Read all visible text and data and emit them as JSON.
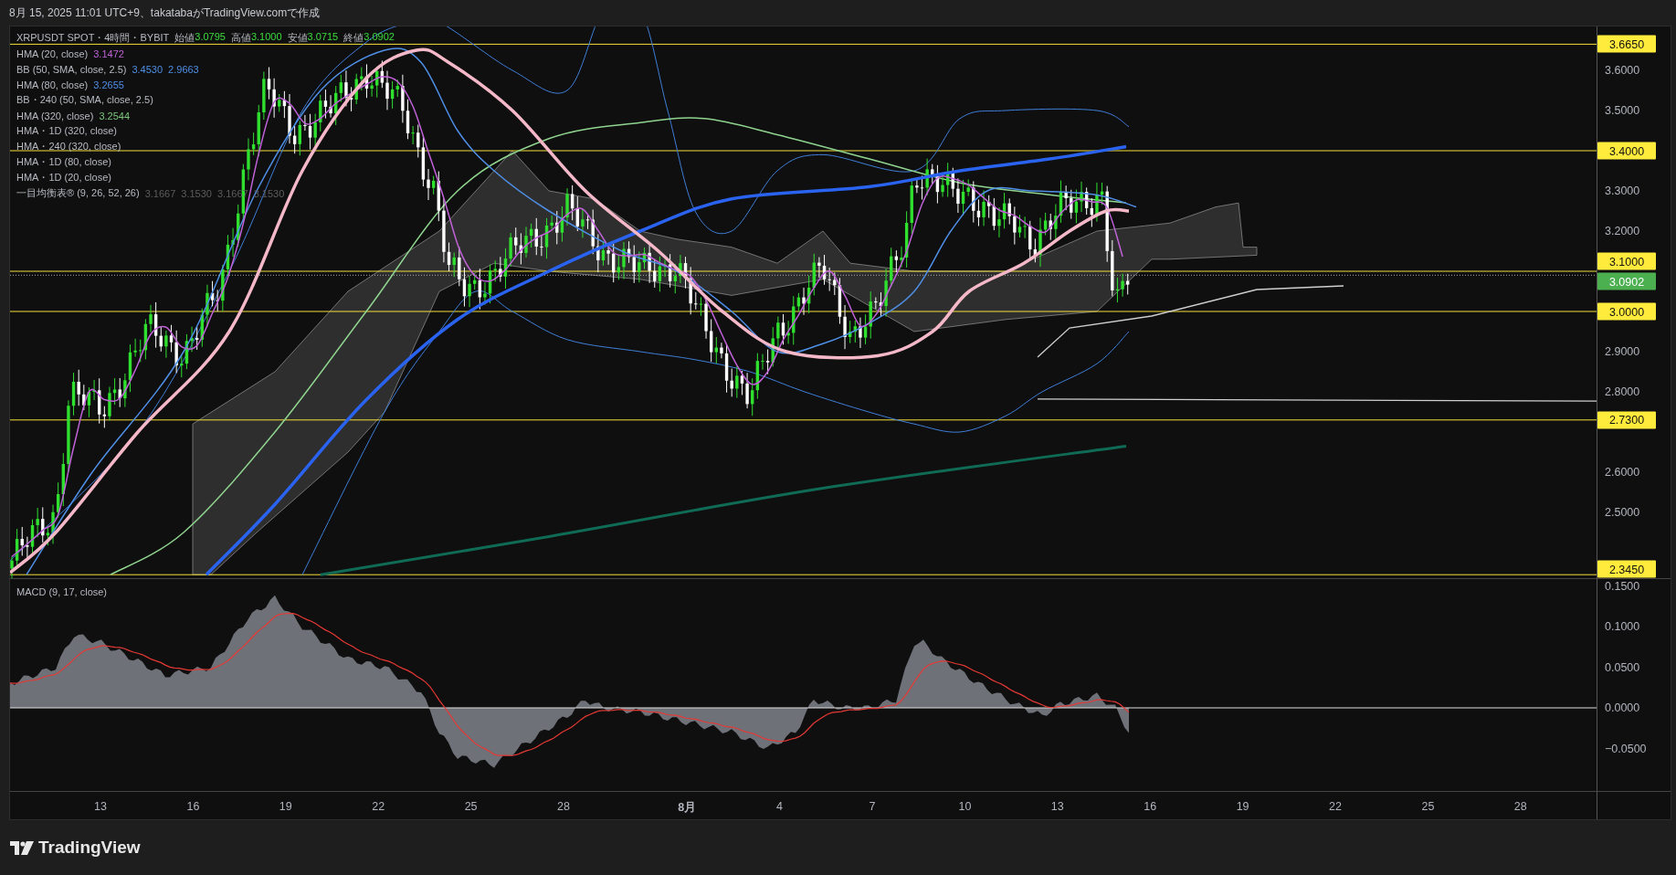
{
  "header": {
    "caption": "8月 15, 2025 11:01 UTC+9、takatabaがTradingView.comで作成"
  },
  "legend": {
    "symbol": "XRPUSDT SPOT・4時間・BYBIT",
    "ohlc": [
      {
        "label": "始値",
        "value": "3.0795"
      },
      {
        "label": "高値",
        "value": "3.1000"
      },
      {
        "label": "安値",
        "value": "3.0715"
      },
      {
        "label": "終値",
        "value": "3.0902"
      }
    ],
    "indicators": [
      {
        "name": "HMA (20, close)",
        "values": [
          "3.1472"
        ],
        "color": "#c062d8"
      },
      {
        "name": "BB (50, SMA, close, 2.5)",
        "values": [
          "3.4530",
          "2.9663"
        ],
        "color": "#4f8fe6"
      },
      {
        "name": "HMA (80, close)",
        "values": [
          "3.2655"
        ],
        "color": "#4f8fe6"
      },
      {
        "name": "BB・240 (50, SMA, close, 2.5)"
      },
      {
        "name": "HMA (320, close)",
        "values": [
          "3.2544"
        ],
        "color": "#7bc67b"
      },
      {
        "name": "HMA・1D (320, close)"
      },
      {
        "name": "HMA・240 (320, close)"
      },
      {
        "name": "HMA・1D (80, close)"
      },
      {
        "name": "HMA・1D (20, close)"
      },
      {
        "name": "一目均衡表® (9, 26, 52, 26)",
        "values": [
          "3.1667",
          "3.1530",
          "3.1667",
          "3.1530"
        ],
        "color": "#5d5d5d"
      }
    ]
  },
  "price_axis": {
    "ticks": [
      "3.6000",
      "3.5000",
      "3.3000",
      "3.2000",
      "2.9000",
      "2.8000",
      "2.6000",
      "2.5000"
    ],
    "badges": [
      {
        "value": "3.6650",
        "color": "#ffeb3b"
      },
      {
        "value": "3.4000",
        "color": "#ffeb3b"
      },
      {
        "value": "3.1000",
        "color": "#ffeb3b"
      },
      {
        "value": "3.0902",
        "color": "#4caf50"
      },
      {
        "value": "3.0000",
        "color": "#ffeb3b"
      },
      {
        "value": "2.7300",
        "color": "#ffeb3b"
      },
      {
        "value": "2.3450",
        "color": "#ffeb3b"
      }
    ]
  },
  "macd": {
    "label": "MACD (9, 17, close)",
    "ticks": [
      "0.1500",
      "0.1000",
      "0.0500",
      "0.0000",
      "−0.0500"
    ]
  },
  "time_axis": [
    {
      "label": "13",
      "major": false
    },
    {
      "label": "16",
      "major": false
    },
    {
      "label": "19",
      "major": false
    },
    {
      "label": "22",
      "major": false
    },
    {
      "label": "25",
      "major": false
    },
    {
      "label": "28",
      "major": false
    },
    {
      "label": "8月",
      "major": true
    },
    {
      "label": "4",
      "major": false
    },
    {
      "label": "7",
      "major": false
    },
    {
      "label": "10",
      "major": false
    },
    {
      "label": "13",
      "major": false
    },
    {
      "label": "16",
      "major": false
    },
    {
      "label": "19",
      "major": false
    },
    {
      "label": "22",
      "major": false
    },
    {
      "label": "25",
      "major": false
    },
    {
      "label": "28",
      "major": false
    }
  ],
  "footer": {
    "brand": "TradingView"
  }
}
